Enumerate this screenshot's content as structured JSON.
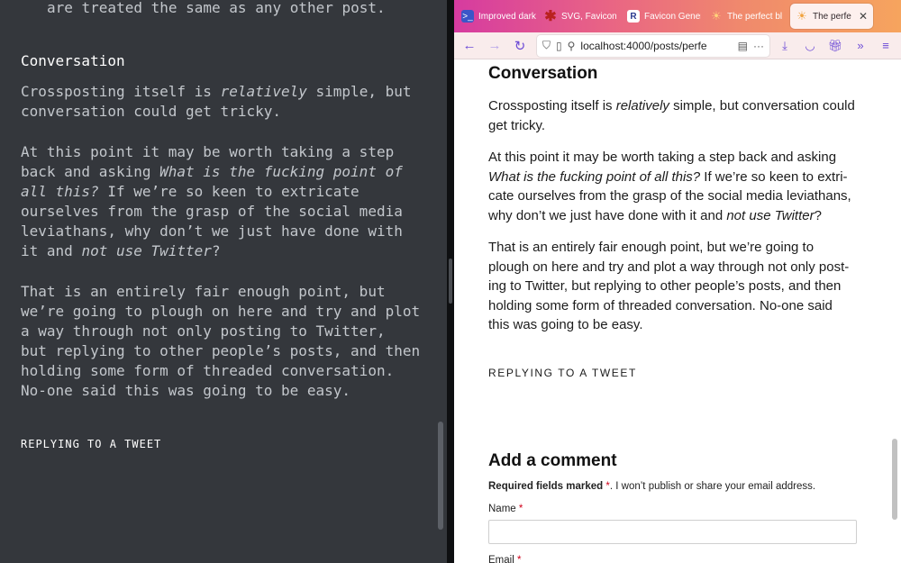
{
  "editor": {
    "lines_top": "are treated the same as any other post.",
    "heading": "Conversation",
    "p1": [
      "Crossposting itself is ",
      "relatively",
      " simple, but",
      "conversation could get tricky."
    ],
    "p2": {
      "l1": "At this point it may be worth taking a step",
      "l2a": "back and asking ",
      "l2b": "What is the fucking point of",
      "l3a": "all this?",
      "l3b": " If we’re so keen to extricate",
      "l4": "ourselves from the grasp of the social media",
      "l5": "leviathans, why don’t we just have done with",
      "l6a": "it and ",
      "l6b": "not use Twitter",
      "l6c": "?"
    },
    "p3": [
      "That is an entirely fair enough point, but",
      "we’re going to plough on here and try and plot",
      "a way through not only posting to Twitter,",
      "but replying to other people’s posts, and then",
      "holding some form of threaded conversation.",
      "No-one said this was going to be easy."
    ],
    "subheading": "REPLYING TO A TWEET"
  },
  "browser": {
    "tabs": [
      {
        "label": "Improved dark",
        "icon": "terminal-icon"
      },
      {
        "label": "SVG, Favicons",
        "icon": "asterisk-icon"
      },
      {
        "label": "Favicon Gener",
        "icon": "r-logo-icon"
      },
      {
        "label": "The perfect bl",
        "icon": "sun-icon"
      },
      {
        "label": "The perfect",
        "icon": "sun-icon"
      }
    ],
    "url": "localhost:4000/posts/perfe",
    "page": {
      "heading": "Conversation",
      "p1": [
        "Crossposting itself is ",
        "relatively",
        " simple, but conversation could",
        "get tricky."
      ],
      "p2": {
        "l1": "At this point it may be worth taking a step back and asking",
        "l2a": "What is the fucking point of all this?",
        "l2b": " If we’re so keen to extri-",
        "l3": "cate ourselves from the grasp of the social media leviathans,",
        "l4a": "why don’t we just have done with it and ",
        "l4b": "not use Twitter",
        "l4c": "?"
      },
      "p3": [
        "That is an entirely fair enough point, but we’re going to",
        "plough on here and try and plot a way through not only post-",
        "ing to Twitter, but replying to other people’s posts, and then",
        "holding some form of threaded conversation. No-one said",
        "this was going to be easy."
      ],
      "subheading": "REPLYING TO A TWEET",
      "comment_heading": "Add a comment",
      "required_bold": "Required fields marked",
      "required_star": "*",
      "required_rest": ". I won’t publish or share your email address.",
      "name_label": "Name",
      "email_label": "Email",
      "star": "*"
    }
  },
  "colors": {
    "editor_bg": "#34373c",
    "required_star": "#d0021b",
    "accent": "#6c4bd6"
  }
}
